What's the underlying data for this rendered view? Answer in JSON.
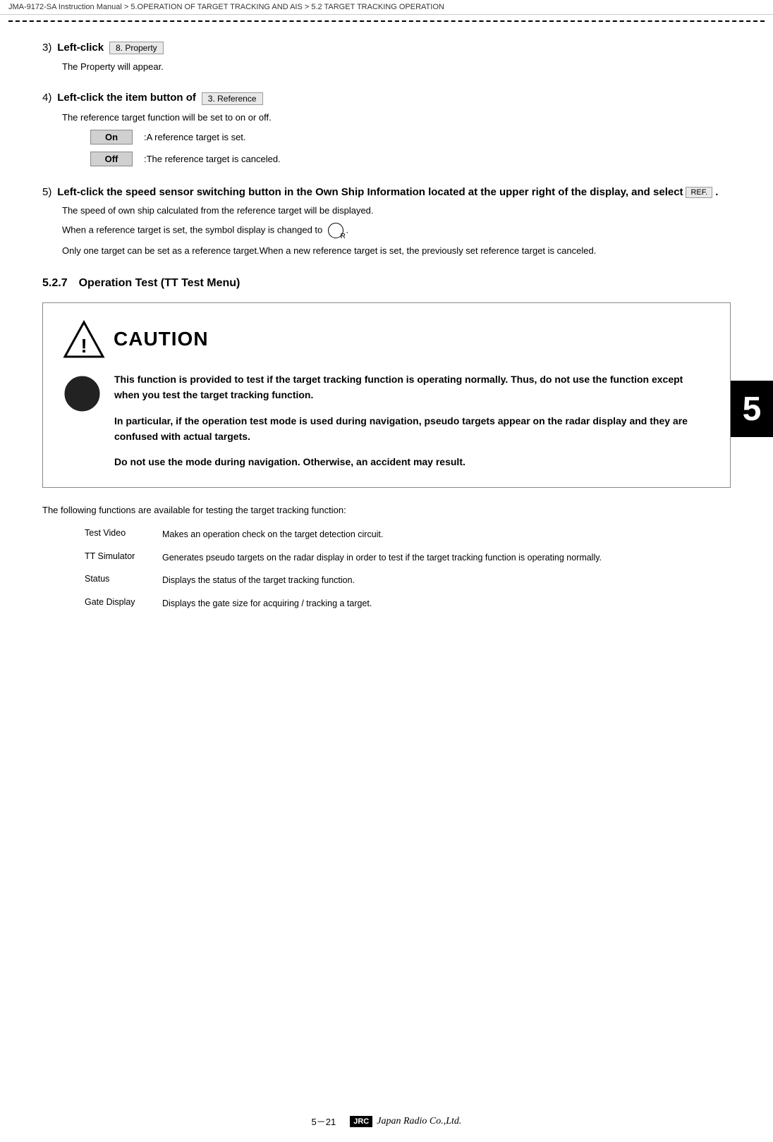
{
  "header": {
    "breadcrumb": "JMA-9172-SA Instruction Manual  >  5.OPERATION OF TARGET TRACKING AND AIS  >  5.2  TARGET TRACKING OPERATION"
  },
  "steps": {
    "step3": {
      "number": "3)",
      "action": "Left-click",
      "btn_label": "8. Property",
      "desc": "The Property will appear."
    },
    "step4": {
      "number": "4)",
      "action": "Left-click the item button of",
      "btn_label": "3. Reference",
      "desc": "The reference target function will be set to on or off.",
      "on_label": "On",
      "on_desc": ":A reference target is set.",
      "off_label": "Off",
      "off_desc": ":The reference target is canceled."
    },
    "step5": {
      "number": "5)",
      "action": "Left-click the speed sensor switching button in the Own Ship Information located at the upper right of the display, and select",
      "ref_label": "REF.",
      "action_end": ".",
      "desc1": "The speed of own ship calculated from the reference target will be displayed.",
      "desc2": "When a reference target is set, the symbol display is changed to",
      "desc2_end": ".",
      "desc3": "Only one target can be set as a reference target.When a new reference target is set, the previously set reference target is canceled."
    }
  },
  "section_527": {
    "number": "5.2.7",
    "title": "Operation Test  (TT Test Menu)"
  },
  "caution": {
    "title": "CAUTION",
    "para1": "This function is provided to test if the target tracking function is operating normally. Thus, do not use the function except when you test the target tracking function.",
    "para2": "In particular, if the operation test mode is used during navigation, pseudo targets appear on the radar display and they are confused with actual targets.",
    "para3": "Do not use the mode during navigation. Otherwise, an accident may result."
  },
  "following": {
    "text": "The following functions are available for testing the target tracking function:"
  },
  "functions": [
    {
      "name": "Test Video",
      "desc": "Makes an operation check on the target detection circuit."
    },
    {
      "name": "TT Simulator",
      "desc": "Generates pseudo targets on the radar display in order to test if the target tracking function is operating normally."
    },
    {
      "name": "Status",
      "desc": "Displays the status of the target tracking function."
    },
    {
      "name": "Gate Display",
      "desc": "Displays the gate size for acquiring / tracking a target."
    }
  ],
  "footer": {
    "page": "5－21",
    "jrc_box": "JRC",
    "jrc_name": "Japan Radio Co.,Ltd."
  },
  "chapter_badge": "5"
}
